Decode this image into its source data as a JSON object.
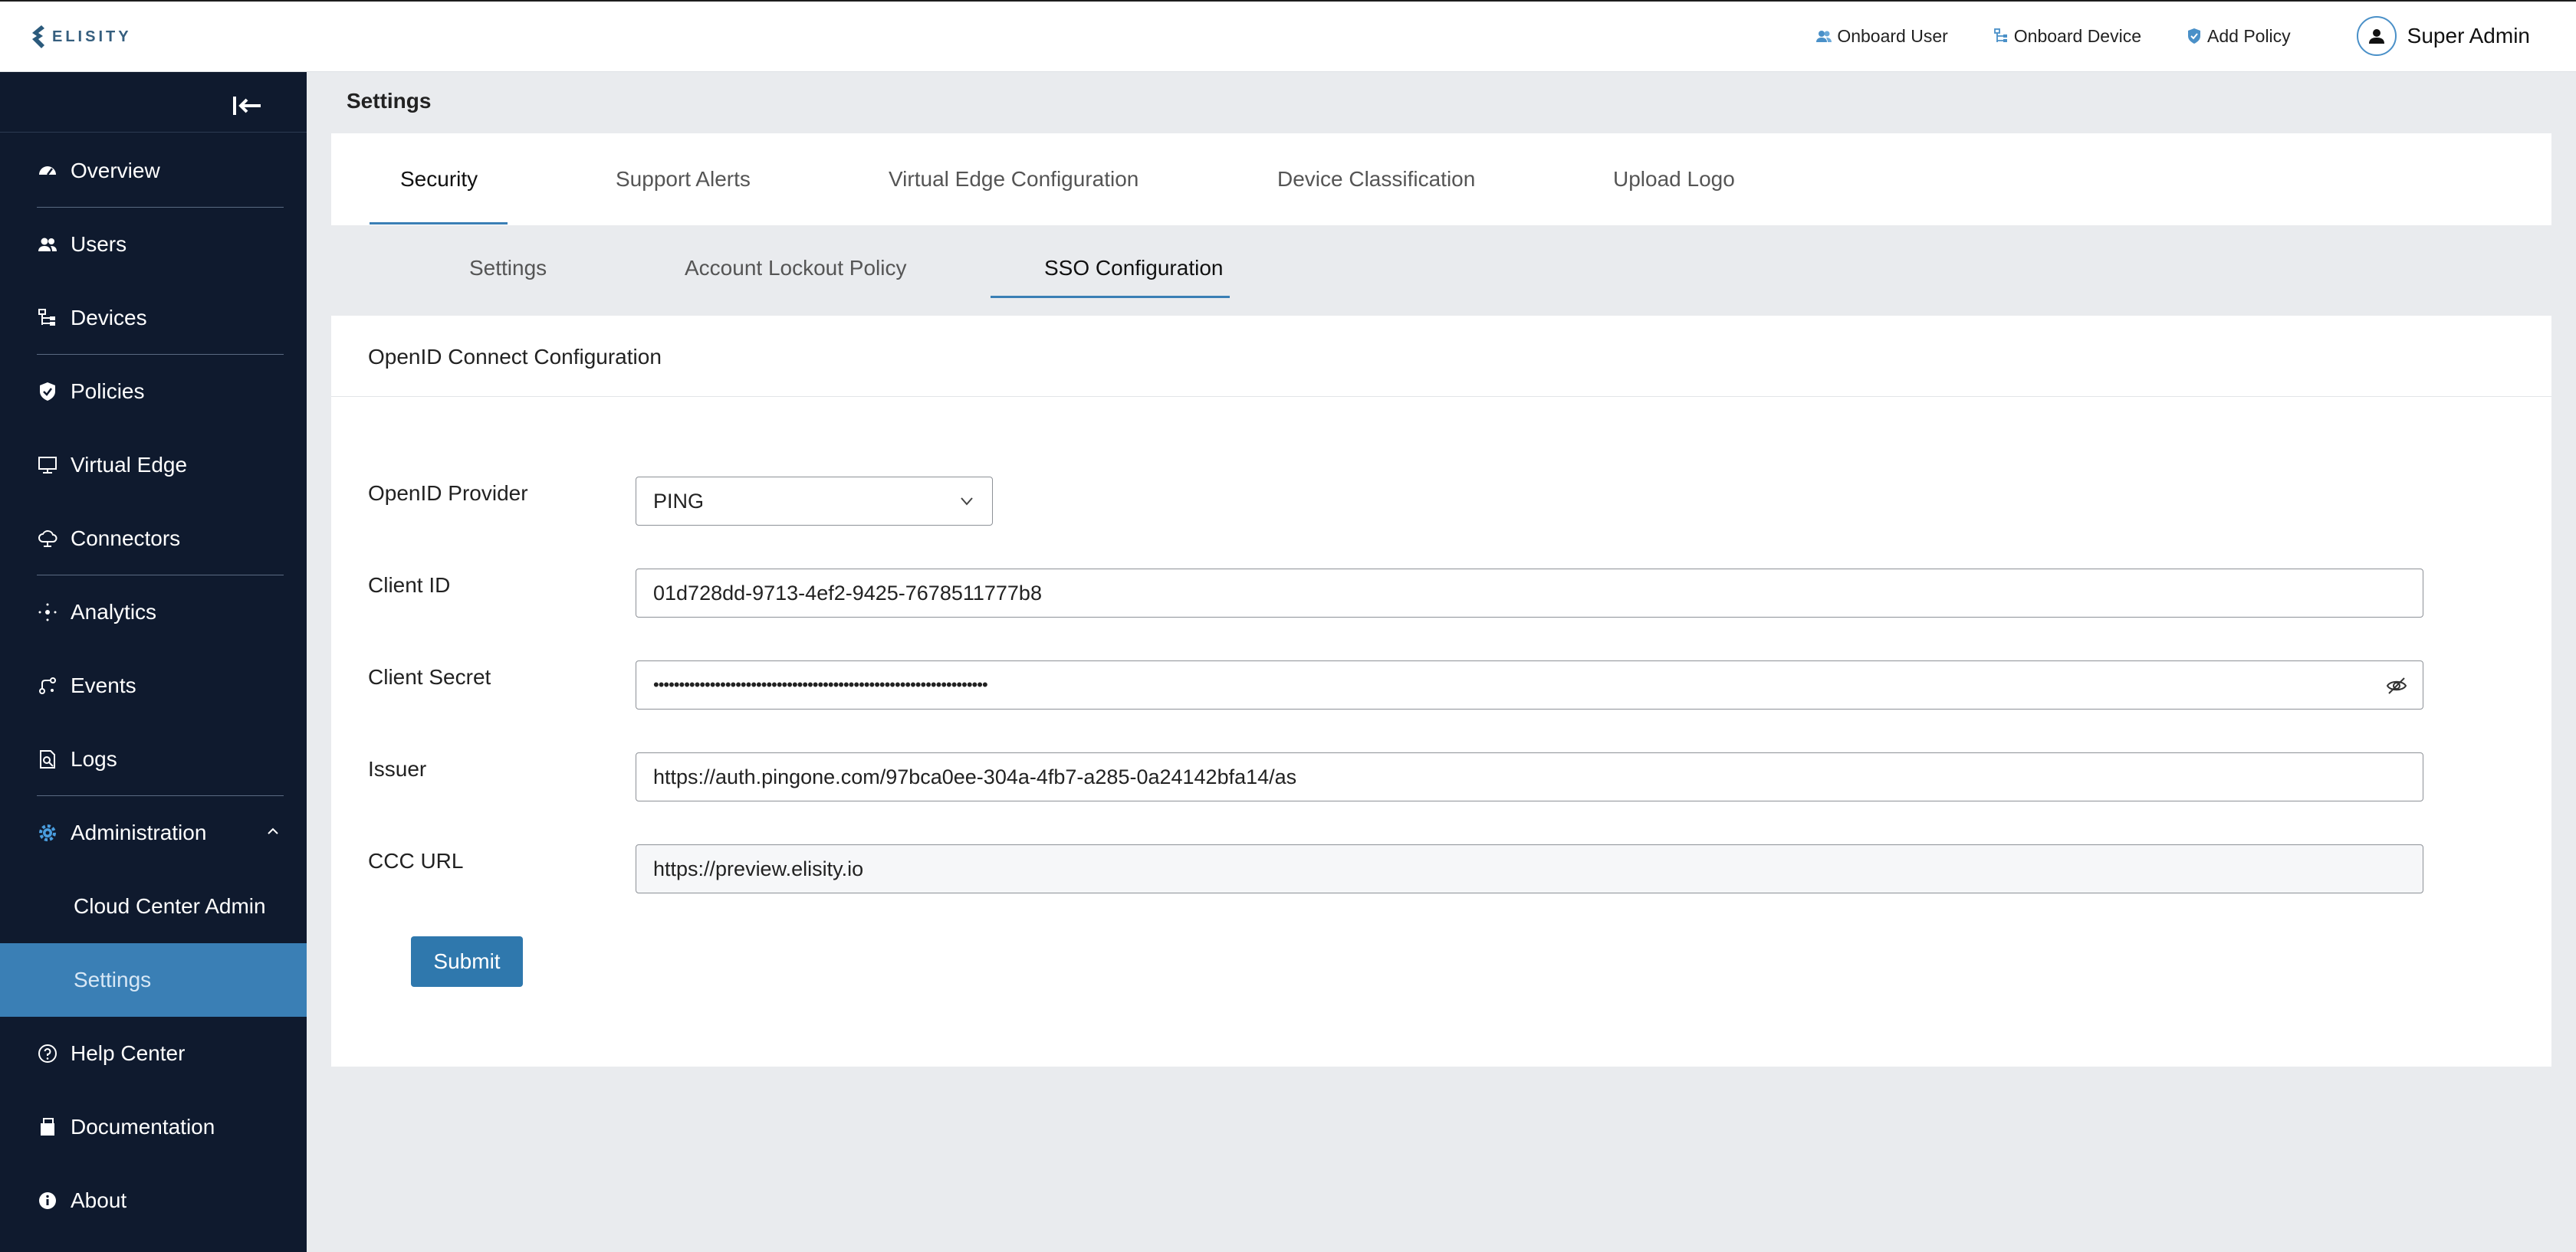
{
  "colors": {
    "sidebar_bg": "#0f1a2e",
    "accent": "#3a7fb5",
    "button": "#2f78ad"
  },
  "header": {
    "logo_text": "ELISITY",
    "actions": [
      {
        "label": "Onboard User",
        "icon": "users-icon"
      },
      {
        "label": "Onboard Device",
        "icon": "device-icon"
      },
      {
        "label": "Add Policy",
        "icon": "shield-icon"
      }
    ],
    "user": {
      "name": "Super Admin",
      "icon": "user-icon"
    }
  },
  "sidebar": {
    "items": [
      {
        "label": "Overview",
        "icon": "speedometer-icon"
      },
      {
        "label": "Users",
        "icon": "users-icon"
      },
      {
        "label": "Devices",
        "icon": "devices-icon"
      },
      {
        "label": "Policies",
        "icon": "shield-icon"
      },
      {
        "label": "Virtual Edge",
        "icon": "monitor-icon"
      },
      {
        "label": "Connectors",
        "icon": "cloud-icon"
      },
      {
        "label": "Analytics",
        "icon": "analytics-icon"
      },
      {
        "label": "Events",
        "icon": "events-icon"
      },
      {
        "label": "Logs",
        "icon": "logs-icon"
      },
      {
        "label": "Administration",
        "icon": "gear-icon",
        "expanded": true
      },
      {
        "label": "Cloud Center Admin"
      },
      {
        "label": "Settings",
        "active": true
      },
      {
        "label": "Help Center",
        "icon": "help-icon"
      },
      {
        "label": "Documentation",
        "icon": "document-icon"
      },
      {
        "label": "About",
        "icon": "info-icon"
      }
    ]
  },
  "page": {
    "title": "Settings"
  },
  "tabs": [
    "Security",
    "Support Alerts",
    "Virtual Edge Configuration",
    "Device Classification",
    "Upload Logo"
  ],
  "active_tab": "Security",
  "subtabs": [
    "Settings",
    "Account Lockout Policy",
    "SSO Configuration"
  ],
  "active_subtab": "SSO Configuration",
  "form": {
    "title": "OpenID Connect Configuration",
    "provider_label": "OpenID Provider",
    "provider_value": "PING",
    "client_id_label": "Client ID",
    "client_id_value": "01d728dd-9713-4ef2-9425-7678511777b8",
    "client_secret_label": "Client Secret",
    "client_secret_value": "•••••••••••••••••••••••••••••••••••••••••••••••••••••••••••••••••",
    "issuer_label": "Issuer",
    "issuer_value": "https://auth.pingone.com/97bca0ee-304a-4fb7-a285-0a24142bfa14/as",
    "ccc_url_label": "CCC URL",
    "ccc_url_value": "https://preview.elisity.io",
    "submit_label": "Submit"
  }
}
